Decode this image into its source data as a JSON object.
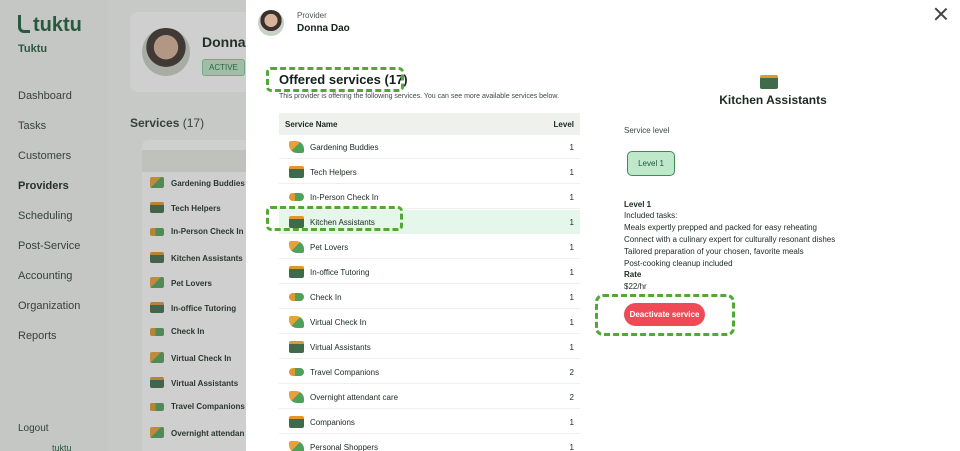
{
  "sidebar": {
    "brand": "tuktu",
    "org_name": "Tuktu",
    "items": [
      {
        "label": "Dashboard"
      },
      {
        "label": "Tasks"
      },
      {
        "label": "Customers"
      },
      {
        "label": "Providers",
        "active": true
      },
      {
        "label": "Scheduling"
      },
      {
        "label": "Post-Service"
      },
      {
        "label": "Accounting"
      },
      {
        "label": "Organization"
      },
      {
        "label": "Reports"
      }
    ],
    "logout": "Logout",
    "footer_brand": "tuktu"
  },
  "background": {
    "profile_name": "Donna D",
    "status": "ACTIVE",
    "services_heading": "Services",
    "services_count": "(17)",
    "services": [
      "Gardening Buddies",
      "Tech Helpers",
      "In-Person Check In",
      "Kitchen Assistants",
      "Pet Lovers",
      "In-office Tutoring",
      "Check In",
      "Virtual Check In",
      "Virtual Assistants",
      "Travel Companions",
      "Overnight attendan"
    ]
  },
  "drawer": {
    "provider_label": "Provider",
    "provider_name": "Donna Dao",
    "offered_title": "Offered services (17)",
    "offered_desc": "This provider is offering the following services. You can see more available services below.",
    "columns": {
      "name": "Service Name",
      "level": "Level"
    },
    "services": [
      {
        "name": "Gardening Buddies",
        "level": "1",
        "icon": "gardening-icon"
      },
      {
        "name": "Tech Helpers",
        "level": "1",
        "icon": "laptop-icon"
      },
      {
        "name": "In-Person Check In",
        "level": "1",
        "icon": "handshake-icon"
      },
      {
        "name": "Kitchen Assistants",
        "level": "1",
        "icon": "cooking-pot-icon",
        "selected": true
      },
      {
        "name": "Pet Lovers",
        "level": "1",
        "icon": "dog-icon"
      },
      {
        "name": "In-office Tutoring",
        "level": "1",
        "icon": "tutoring-icon"
      },
      {
        "name": "Check In",
        "level": "1",
        "icon": "handshake-icon"
      },
      {
        "name": "Virtual Check In",
        "level": "1",
        "icon": "chat-bubble-icon"
      },
      {
        "name": "Virtual Assistants",
        "level": "1",
        "icon": "person-laptop-icon"
      },
      {
        "name": "Travel Companions",
        "level": "2",
        "icon": "car-icon"
      },
      {
        "name": "Overnight attendant care",
        "level": "2",
        "icon": "bed-icon"
      },
      {
        "name": "Companions",
        "level": "1",
        "icon": "companions-icon"
      },
      {
        "name": "Personal Shoppers",
        "level": "1",
        "icon": "shopping-icon"
      }
    ],
    "detail": {
      "title": "Kitchen Assistants",
      "service_level_label": "Service level",
      "level_chip": "Level 1",
      "level_heading": "Level 1",
      "included_label": "Included tasks:",
      "tasks": [
        "Meals expertly prepped and packed for easy reheating",
        "Connect with a culinary expert for culturally resonant dishes",
        "Tailored preparation of your chosen, favorite meals",
        "Post-cooking cleanup included"
      ],
      "rate_label": "Rate",
      "rate_value": "$22/hr",
      "deactivate_label": "Deactivate service"
    }
  },
  "colors": {
    "brand_green": "#1d5b3a",
    "selected_row": "#e5f6ea",
    "danger": "#ee4b57",
    "highlight_dash": "#52a834"
  }
}
